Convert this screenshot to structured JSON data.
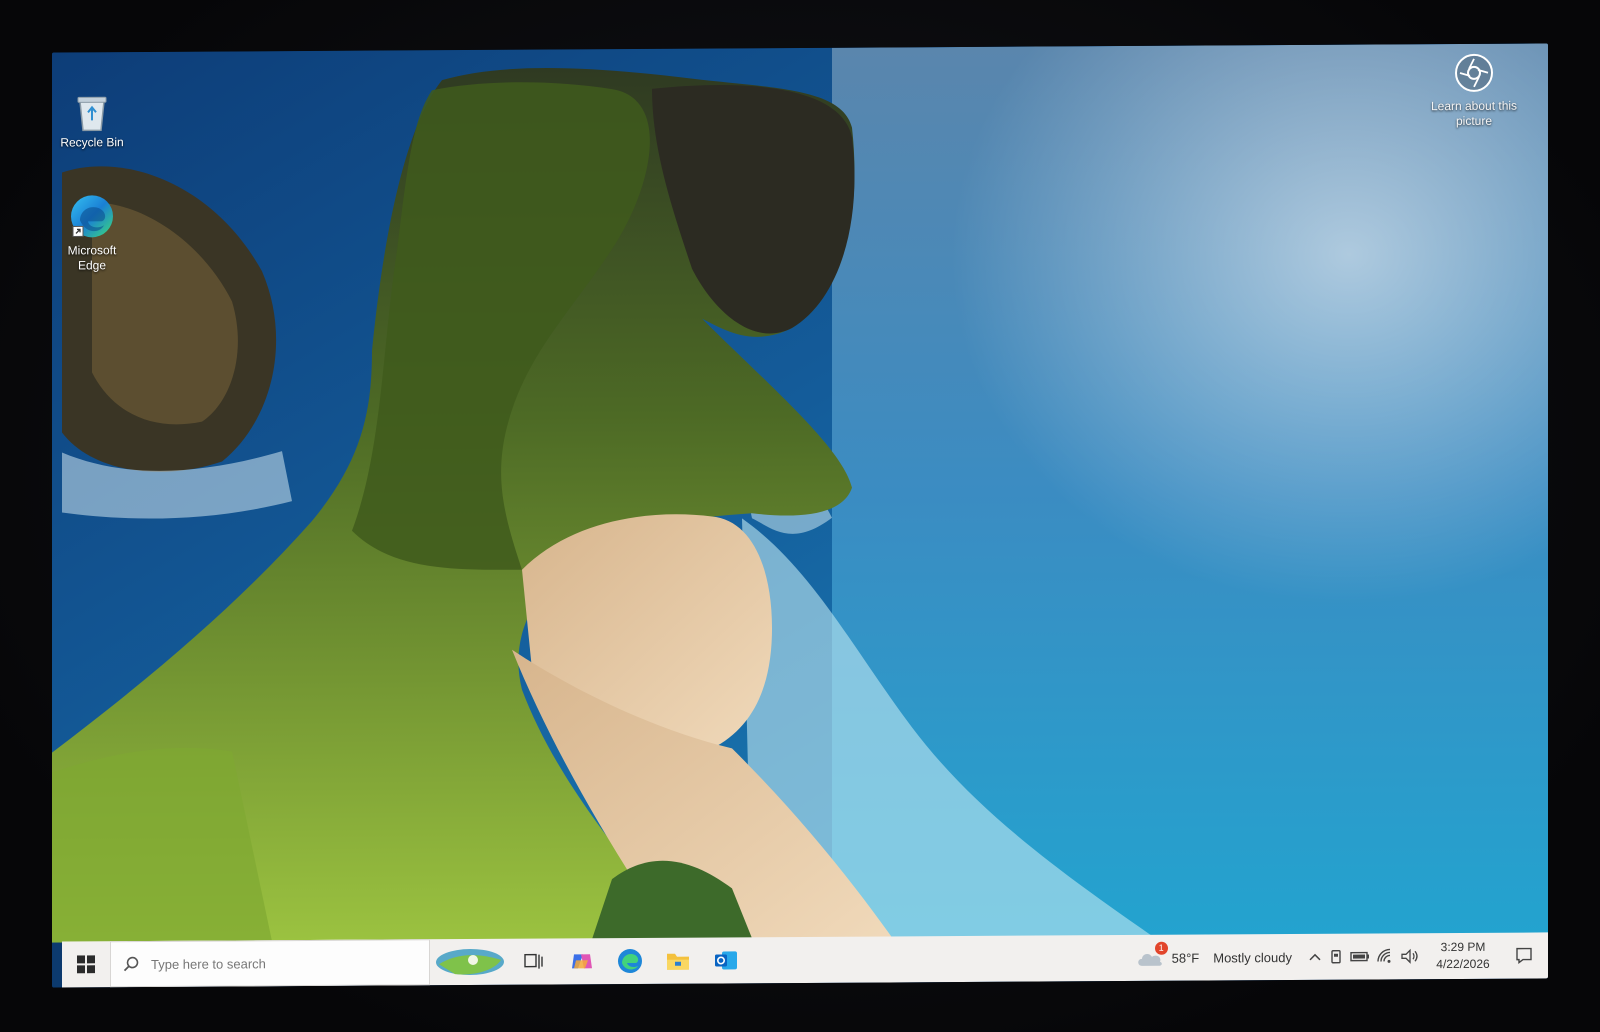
{
  "desktop": {
    "icons": [
      {
        "label": "Recycle Bin",
        "icon": "recycle-bin-icon"
      },
      {
        "label": "Microsoft Edge",
        "icon": "edge-icon"
      }
    ],
    "learn_about_picture": "Learn about this picture"
  },
  "taskbar": {
    "search_placeholder": "Type here to search",
    "pinned": [
      "task-view-icon",
      "copilot-icon",
      "edge-icon",
      "file-explorer-icon",
      "outlook-icon"
    ],
    "weather": {
      "temperature": "58°F",
      "condition": "Mostly cloudy",
      "alert_count": "1"
    },
    "tray_icons": [
      "chevron-up-icon",
      "usb-icon",
      "battery-icon",
      "wifi-icon",
      "volume-icon"
    ],
    "time": "3:29 PM",
    "date": "4/22/2026"
  },
  "colors": {
    "taskbar_bg": "#f2f0ee",
    "ocean": "#1a8fc4",
    "cliff_green": "#7fa832",
    "sand": "#e8c9a2"
  }
}
